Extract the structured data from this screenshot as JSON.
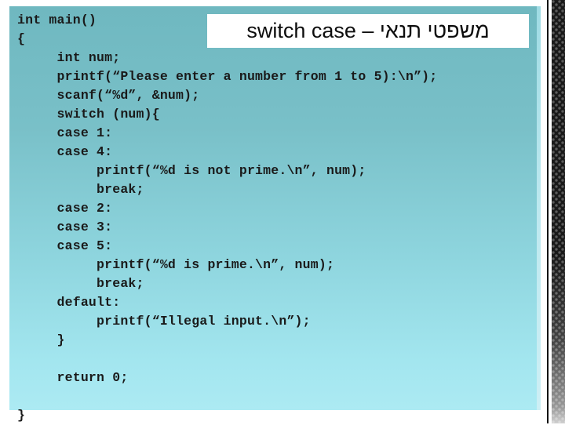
{
  "slide": {
    "title": "משפטי תנאי – switch case",
    "title_language": "he",
    "background_color": "#ffffff",
    "panel": {
      "gradient_top_color": "#6fb8c0",
      "gradient_bottom_color": "#aceaf3"
    },
    "accent_colors": {
      "banner_background": "#ffffff",
      "banner_text": "#0d0d0d",
      "code_text": "#1a1a1a",
      "edge_glow": "#bde8ef",
      "edge_rule": "#111111",
      "edge_texture": "#1a1a1a"
    },
    "code": {
      "language": "c",
      "lines": [
        "int main()",
        "{",
        "     int num;",
        "     printf(“Please enter a number from 1 to 5):\\n”);",
        "     scanf(“%d”, &num);",
        "     switch (num){",
        "     case 1:",
        "     case 4:",
        "          printf(“%d is not prime.\\n”, num);",
        "          break;",
        "     case 2:",
        "     case 3:",
        "     case 5:",
        "          printf(“%d is prime.\\n”, num);",
        "          break;",
        "     default:",
        "          printf(“Illegal input.\\n”);",
        "     }",
        "",
        "     return 0;",
        "",
        "}"
      ]
    }
  }
}
